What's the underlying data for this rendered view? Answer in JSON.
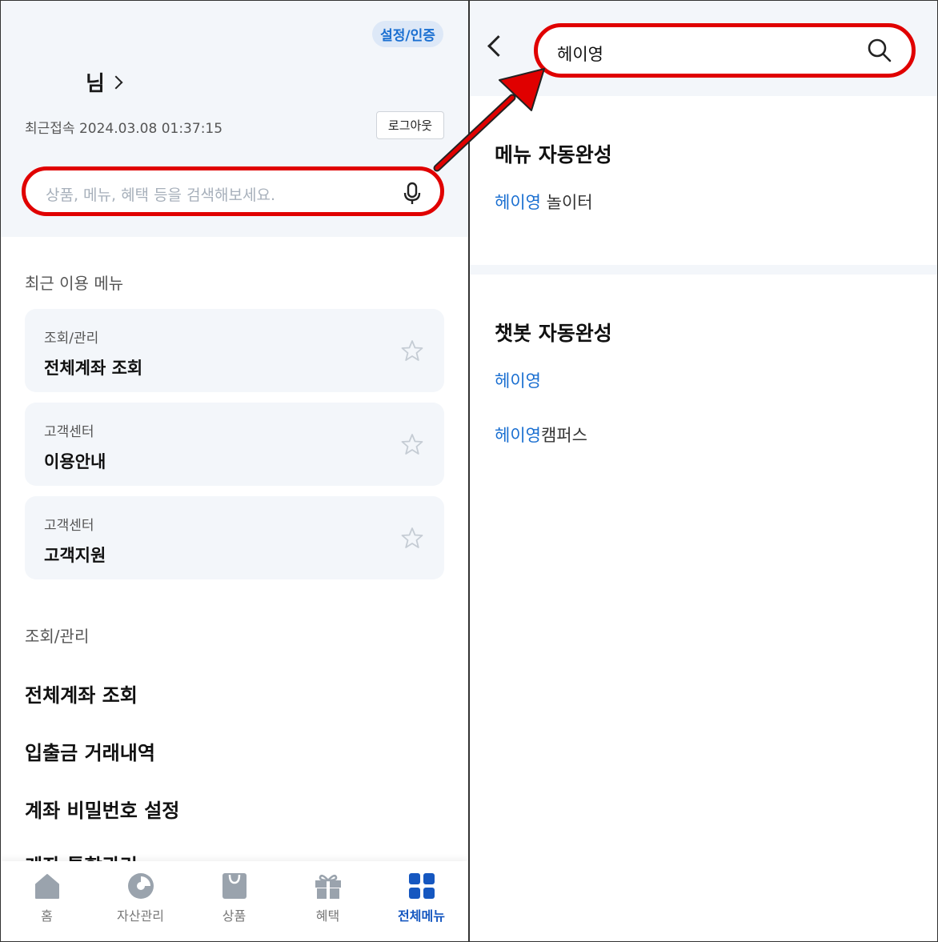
{
  "left": {
    "settings_pill": "설정/인증",
    "user_suffix": "님",
    "last_login": "최근접속 2024.03.08 01:37:15",
    "logout": "로그아웃",
    "search_placeholder": "상품, 메뉴, 혜택 등을 검색해보세요.",
    "recent_label": "최근 이용 메뉴",
    "recent": [
      {
        "category": "조회/관리",
        "title": "전체계좌 조회"
      },
      {
        "category": "고객센터",
        "title": "이용안내"
      },
      {
        "category": "고객센터",
        "title": "고객지원"
      }
    ],
    "section_label": "조회/관리",
    "section_items": [
      "전체계좌 조회",
      "입출금 거래내역",
      "계좌 비밀번호 설정",
      "계좌 통합관리"
    ],
    "tabs": [
      {
        "label": "홈",
        "icon": "home-icon"
      },
      {
        "label": "자산관리",
        "icon": "pie-chart-icon"
      },
      {
        "label": "상품",
        "icon": "shopping-bag-icon"
      },
      {
        "label": "혜택",
        "icon": "gift-icon"
      },
      {
        "label": "전체메뉴",
        "icon": "grid-menu-icon",
        "active": true
      }
    ]
  },
  "right": {
    "search_value": "헤이영",
    "menu_title": "메뉴 자동완성",
    "menu_suggestions": [
      {
        "highlight": "헤이영",
        "rest": " 놀이터"
      }
    ],
    "chatbot_title": "챗봇 자동완성",
    "chatbot_suggestions": [
      {
        "highlight": "헤이영",
        "rest": ""
      },
      {
        "highlight": "헤이영",
        "rest": "캠퍼스"
      }
    ]
  },
  "colors": {
    "accent": "#1a6fd1",
    "active_tab": "#1557c0",
    "highlight_border": "#e00000",
    "bg_soft": "#f3f6fa"
  }
}
